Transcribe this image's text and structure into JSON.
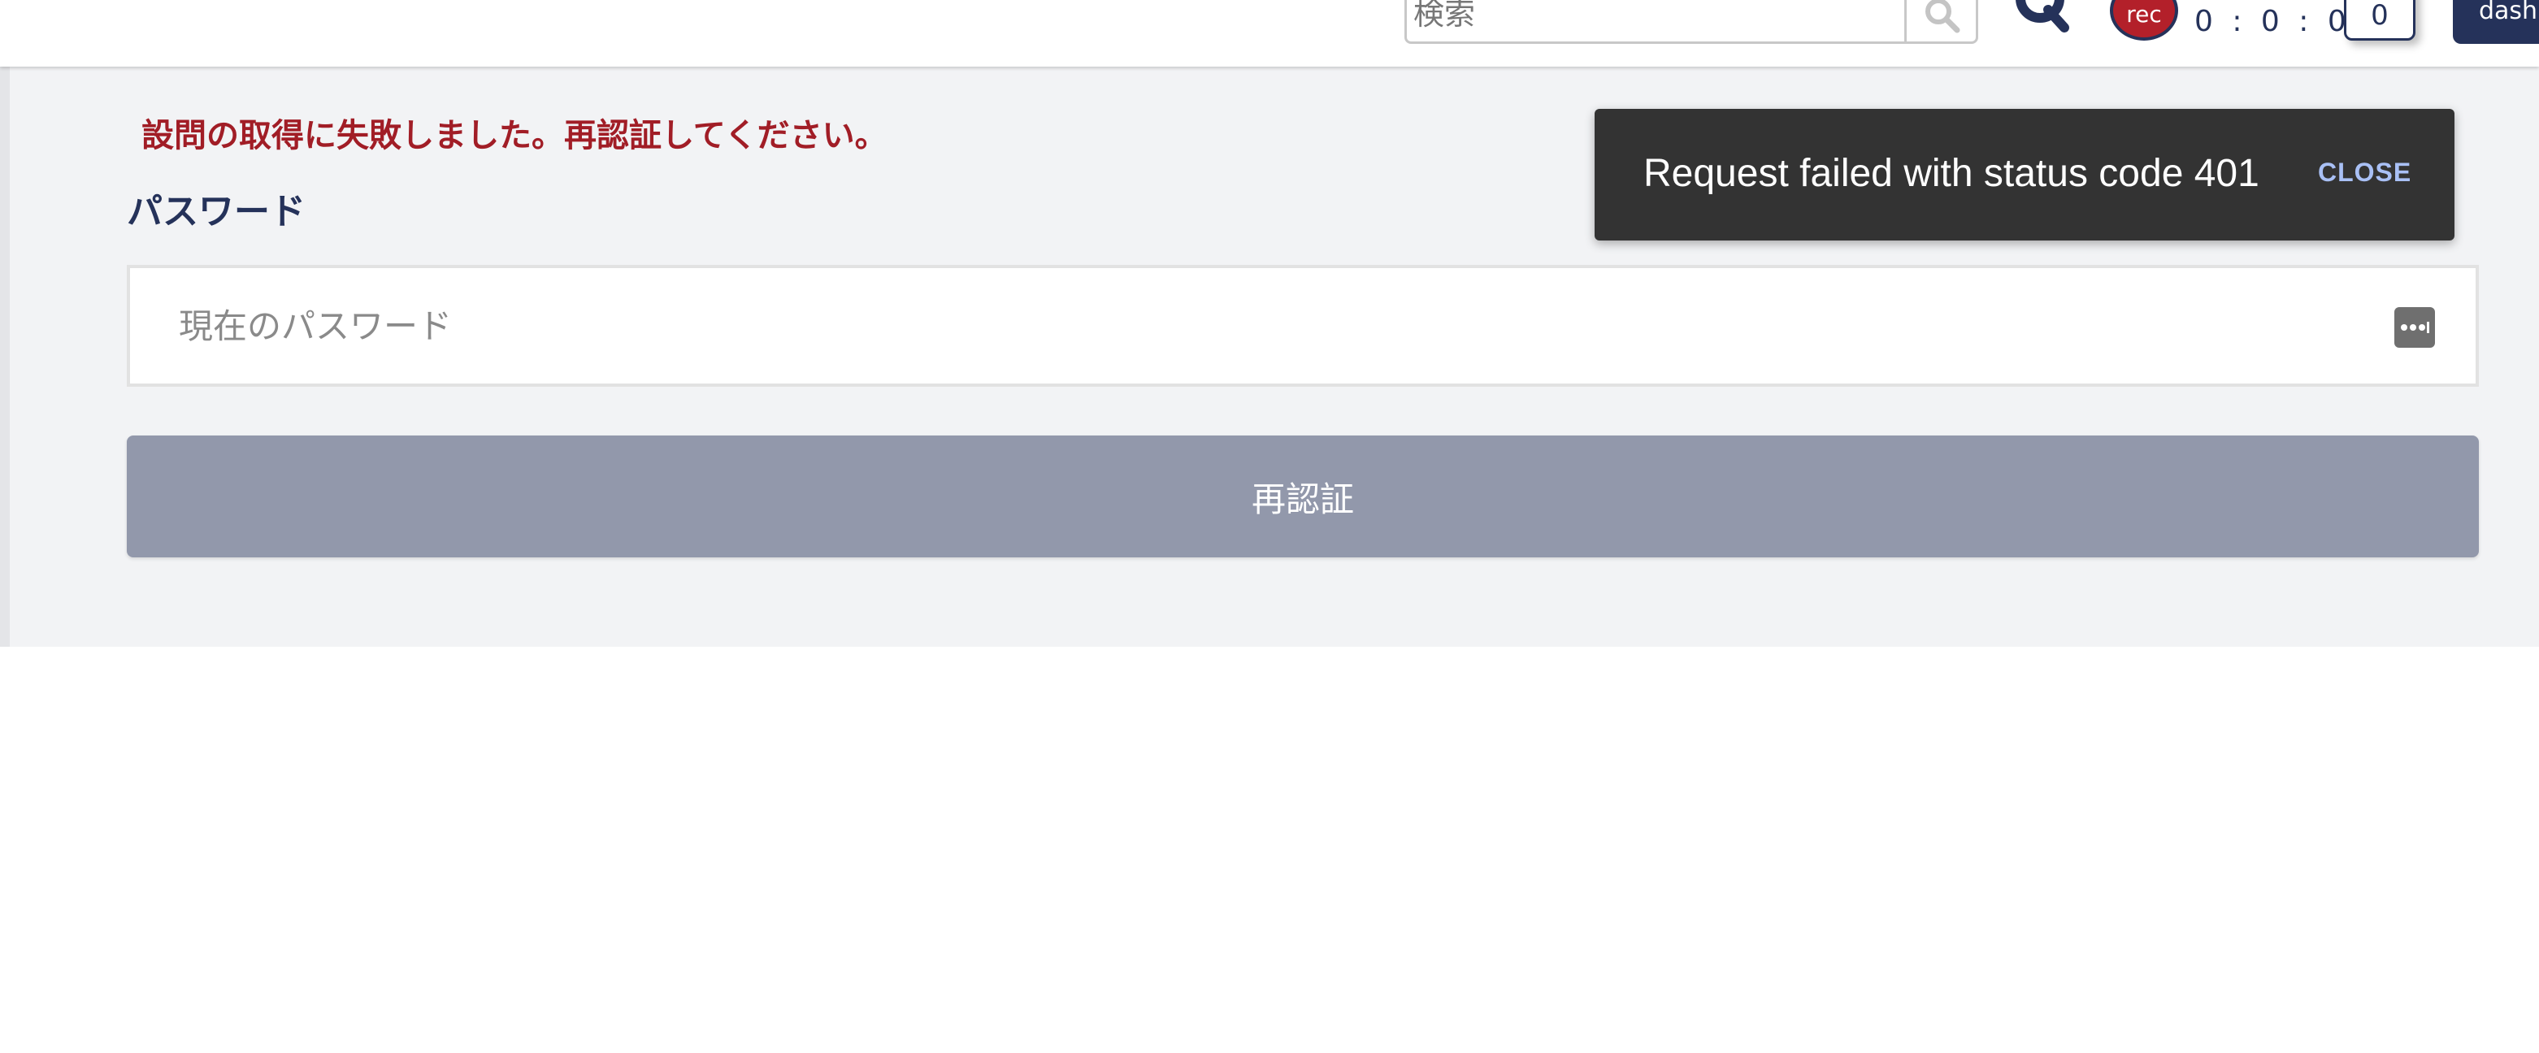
{
  "header": {
    "search": {
      "placeholder": "検索",
      "value": ""
    },
    "search_icon": "search-icon",
    "brand_icon": "q-logo-icon",
    "rec_label": "rec",
    "timer": "0 : 0 : 0",
    "counter": "0",
    "dashboard_label": "dashboard"
  },
  "main": {
    "error_message": "設問の取得に失敗しました。再認証してください。",
    "password_label": "パスワード",
    "password_placeholder": "現在のパスワード",
    "password_manager_icon": "password-manager-icon",
    "reauth_button": "再認証"
  },
  "snackbar": {
    "message": "Request failed with status code 401",
    "close_label": "CLOSE"
  },
  "colors": {
    "navy": "#25325a",
    "error": "#a11d26",
    "rec": "#b3202a",
    "button_disabled": "#9298ab",
    "snackbar_bg": "#333333",
    "snackbar_action": "#a9c0f5"
  }
}
